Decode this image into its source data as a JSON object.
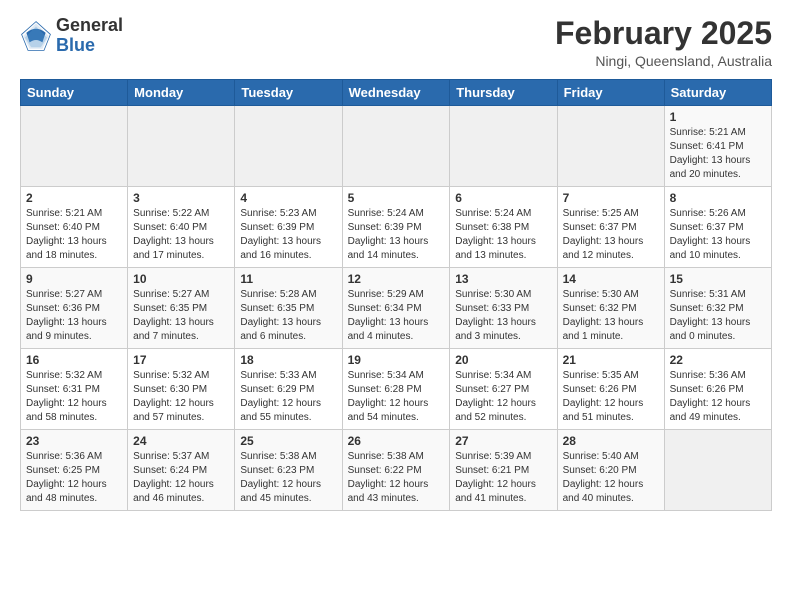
{
  "logo": {
    "general": "General",
    "blue": "Blue"
  },
  "header": {
    "month": "February 2025",
    "location": "Ningi, Queensland, Australia"
  },
  "days_of_week": [
    "Sunday",
    "Monday",
    "Tuesday",
    "Wednesday",
    "Thursday",
    "Friday",
    "Saturday"
  ],
  "weeks": [
    [
      {
        "day": "",
        "info": ""
      },
      {
        "day": "",
        "info": ""
      },
      {
        "day": "",
        "info": ""
      },
      {
        "day": "",
        "info": ""
      },
      {
        "day": "",
        "info": ""
      },
      {
        "day": "",
        "info": ""
      },
      {
        "day": "1",
        "info": "Sunrise: 5:21 AM\nSunset: 6:41 PM\nDaylight: 13 hours\nand 20 minutes."
      }
    ],
    [
      {
        "day": "2",
        "info": "Sunrise: 5:21 AM\nSunset: 6:40 PM\nDaylight: 13 hours\nand 18 minutes."
      },
      {
        "day": "3",
        "info": "Sunrise: 5:22 AM\nSunset: 6:40 PM\nDaylight: 13 hours\nand 17 minutes."
      },
      {
        "day": "4",
        "info": "Sunrise: 5:23 AM\nSunset: 6:39 PM\nDaylight: 13 hours\nand 16 minutes."
      },
      {
        "day": "5",
        "info": "Sunrise: 5:24 AM\nSunset: 6:39 PM\nDaylight: 13 hours\nand 14 minutes."
      },
      {
        "day": "6",
        "info": "Sunrise: 5:24 AM\nSunset: 6:38 PM\nDaylight: 13 hours\nand 13 minutes."
      },
      {
        "day": "7",
        "info": "Sunrise: 5:25 AM\nSunset: 6:37 PM\nDaylight: 13 hours\nand 12 minutes."
      },
      {
        "day": "8",
        "info": "Sunrise: 5:26 AM\nSunset: 6:37 PM\nDaylight: 13 hours\nand 10 minutes."
      }
    ],
    [
      {
        "day": "9",
        "info": "Sunrise: 5:27 AM\nSunset: 6:36 PM\nDaylight: 13 hours\nand 9 minutes."
      },
      {
        "day": "10",
        "info": "Sunrise: 5:27 AM\nSunset: 6:35 PM\nDaylight: 13 hours\nand 7 minutes."
      },
      {
        "day": "11",
        "info": "Sunrise: 5:28 AM\nSunset: 6:35 PM\nDaylight: 13 hours\nand 6 minutes."
      },
      {
        "day": "12",
        "info": "Sunrise: 5:29 AM\nSunset: 6:34 PM\nDaylight: 13 hours\nand 4 minutes."
      },
      {
        "day": "13",
        "info": "Sunrise: 5:30 AM\nSunset: 6:33 PM\nDaylight: 13 hours\nand 3 minutes."
      },
      {
        "day": "14",
        "info": "Sunrise: 5:30 AM\nSunset: 6:32 PM\nDaylight: 13 hours\nand 1 minute."
      },
      {
        "day": "15",
        "info": "Sunrise: 5:31 AM\nSunset: 6:32 PM\nDaylight: 13 hours\nand 0 minutes."
      }
    ],
    [
      {
        "day": "16",
        "info": "Sunrise: 5:32 AM\nSunset: 6:31 PM\nDaylight: 12 hours\nand 58 minutes."
      },
      {
        "day": "17",
        "info": "Sunrise: 5:32 AM\nSunset: 6:30 PM\nDaylight: 12 hours\nand 57 minutes."
      },
      {
        "day": "18",
        "info": "Sunrise: 5:33 AM\nSunset: 6:29 PM\nDaylight: 12 hours\nand 55 minutes."
      },
      {
        "day": "19",
        "info": "Sunrise: 5:34 AM\nSunset: 6:28 PM\nDaylight: 12 hours\nand 54 minutes."
      },
      {
        "day": "20",
        "info": "Sunrise: 5:34 AM\nSunset: 6:27 PM\nDaylight: 12 hours\nand 52 minutes."
      },
      {
        "day": "21",
        "info": "Sunrise: 5:35 AM\nSunset: 6:26 PM\nDaylight: 12 hours\nand 51 minutes."
      },
      {
        "day": "22",
        "info": "Sunrise: 5:36 AM\nSunset: 6:26 PM\nDaylight: 12 hours\nand 49 minutes."
      }
    ],
    [
      {
        "day": "23",
        "info": "Sunrise: 5:36 AM\nSunset: 6:25 PM\nDaylight: 12 hours\nand 48 minutes."
      },
      {
        "day": "24",
        "info": "Sunrise: 5:37 AM\nSunset: 6:24 PM\nDaylight: 12 hours\nand 46 minutes."
      },
      {
        "day": "25",
        "info": "Sunrise: 5:38 AM\nSunset: 6:23 PM\nDaylight: 12 hours\nand 45 minutes."
      },
      {
        "day": "26",
        "info": "Sunrise: 5:38 AM\nSunset: 6:22 PM\nDaylight: 12 hours\nand 43 minutes."
      },
      {
        "day": "27",
        "info": "Sunrise: 5:39 AM\nSunset: 6:21 PM\nDaylight: 12 hours\nand 41 minutes."
      },
      {
        "day": "28",
        "info": "Sunrise: 5:40 AM\nSunset: 6:20 PM\nDaylight: 12 hours\nand 40 minutes."
      },
      {
        "day": "",
        "info": ""
      }
    ]
  ]
}
